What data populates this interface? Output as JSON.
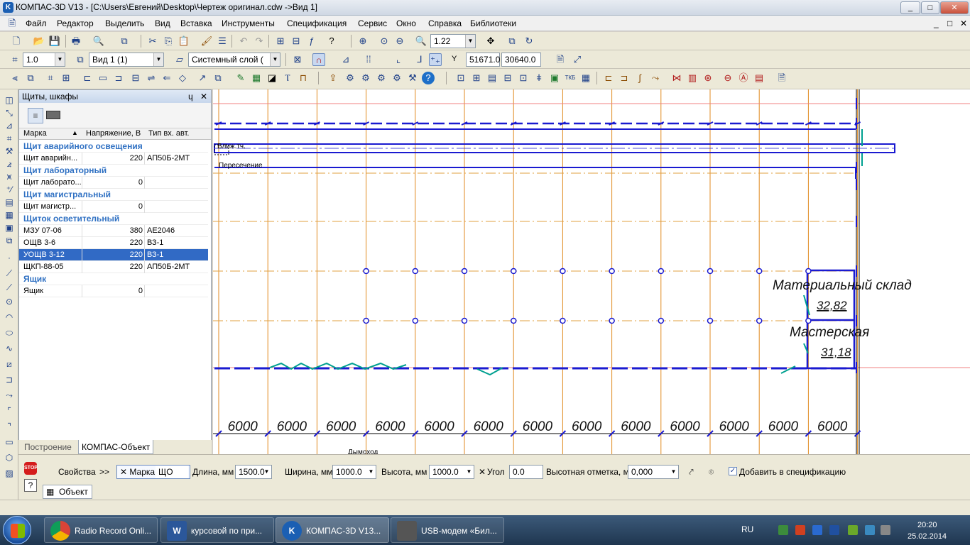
{
  "window": {
    "title": "КОМПАС-3D V13 - [C:\\Users\\Евгений\\Desktop\\Чертеж оригинал.cdw ->Вид 1]",
    "minimize": "_",
    "maximize": "□",
    "close": "✕"
  },
  "menu": [
    "Файл",
    "Редактор",
    "Выделить",
    "Вид",
    "Вставка",
    "Инструменты",
    "Спецификация",
    "Сервис",
    "Окно",
    "Справка",
    "Библиотеки"
  ],
  "doc_controls": [
    "_",
    "□",
    "✕"
  ],
  "toolbar1": {
    "zoom": "1.22"
  },
  "toolbar2": {
    "scale": "1.0",
    "view": "Вид 1 (1)",
    "layer": "Системный слой (",
    "coord_x": "51671.0",
    "coord_y": "30640.0",
    "coord_label": "Y"
  },
  "panel": {
    "title": "Щиты, шкафы",
    "pin": "ɥ",
    "close": "✕",
    "columns": [
      "Марка",
      "Напряжение, В",
      "Тип вх. авт."
    ],
    "rows": [
      {
        "type": "group",
        "name": "Щит аварийного освещения"
      },
      {
        "type": "item",
        "mark": "Щит аварийн...",
        "voltage": "220",
        "breaker": "АП50Б-2МТ"
      },
      {
        "type": "group",
        "name": "Щит лабораторный"
      },
      {
        "type": "item",
        "mark": "Щит лаборато...",
        "voltage": "0",
        "breaker": ""
      },
      {
        "type": "group",
        "name": "Щит магистральный"
      },
      {
        "type": "item",
        "mark": "Щит магистр...",
        "voltage": "0",
        "breaker": ""
      },
      {
        "type": "group",
        "name": "Щиток осветительный"
      },
      {
        "type": "item",
        "mark": "МЗУ 07-06",
        "voltage": "380",
        "breaker": "АЕ2046"
      },
      {
        "type": "item",
        "mark": "ОЩВ 3-6",
        "voltage": "220",
        "breaker": "ВЗ-1"
      },
      {
        "type": "item",
        "mark": "УОЩВ 3-12",
        "voltage": "220",
        "breaker": "ВЗ-1",
        "selected": true
      },
      {
        "type": "item",
        "mark": "ЩКП-88-05",
        "voltage": "220",
        "breaker": "АП50Б-2МТ"
      },
      {
        "type": "group",
        "name": "Ящик"
      },
      {
        "type": "item",
        "mark": "Ящик",
        "voltage": "0",
        "breaker": ""
      }
    ],
    "tabs": [
      "Построение",
      "КОМПАС-Объект"
    ]
  },
  "drawing": {
    "dimension_label": "6000",
    "dimension_count": 13,
    "room1_name": "Материальный склад",
    "room1_area": "32,82",
    "room2_name": "Мастерская",
    "room2_area": "31,18",
    "tooltip1": "Ближ.тч.",
    "tooltip2": "Пересечение",
    "tooltip3": "Дымоход"
  },
  "properties": {
    "props_button": "Свойства",
    "expand": ">>",
    "mark_label": "Марка",
    "mark_value": "ЩО",
    "length_label": "Длина, мм",
    "length_value": "1500.0",
    "width_label": "Ширина, мм",
    "width_value": "1000.0",
    "height_label": "Высота, мм",
    "height_value": "1000.0",
    "angle_label": "Угол",
    "angle_value": "0.0",
    "elevation_label": "Высотная отметка, м",
    "elevation_value": "0,000",
    "spec_label": "Добавить в спецификацию",
    "object_tab": "Объект",
    "stop": "STOP",
    "help": "?"
  },
  "taskbar": {
    "tasks": [
      "Radio Record Onli...",
      "курсовой по при...",
      "КОМПАС-3D V13...",
      "USB-модем «Бил..."
    ],
    "lang": "RU",
    "time": "20:20",
    "date": "25.02.2014"
  }
}
